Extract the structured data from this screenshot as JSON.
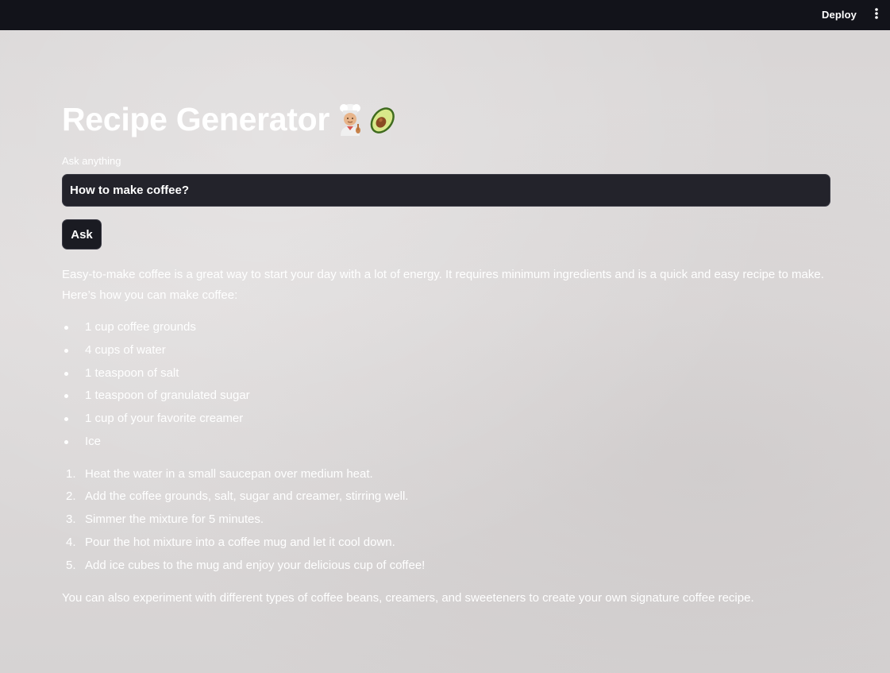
{
  "topbar": {
    "deploy_label": "Deploy",
    "menu_icon": "vertical-ellipsis-icon"
  },
  "page": {
    "title": "Recipe Generator",
    "title_icons": [
      "chef-emoji",
      "avocado-emoji"
    ]
  },
  "form": {
    "label": "Ask anything",
    "input_value": "How to make coffee?",
    "button_label": "Ask"
  },
  "answer": {
    "intro": "Easy-to-make coffee is a great way to start your day with a lot of energy. It requires minimum ingredients and is a quick and easy recipe to make. Here’s how you can make coffee:",
    "ingredients": [
      "1 cup coffee grounds",
      "4 cups of water",
      "1 teaspoon of salt",
      "1 teaspoon of granulated sugar",
      "1 cup of your favorite creamer",
      "Ice"
    ],
    "steps": [
      {
        "num": "1.",
        "text": "Heat the water in a small saucepan over medium heat."
      },
      {
        "num": "2.",
        "text": "Add the coffee grounds, salt, sugar and creamer, stirring well."
      },
      {
        "num": "3.",
        "text": "Simmer the mixture for 5 minutes."
      },
      {
        "num": "4.",
        "text": "Pour the hot mixture into a coffee mug and let it cool down."
      },
      {
        "num": "5.",
        "text": "Add ice cubes to the mug and enjoy your delicious cup of coffee!"
      }
    ],
    "outro": "You can also experiment with different types of coffee beans, creamers, and sweeteners to create your own signature coffee recipe."
  },
  "colors": {
    "topbar": "#12131a",
    "page_background": "#dcd9d9",
    "input_background": "#23232b",
    "text": "#ffffff"
  }
}
